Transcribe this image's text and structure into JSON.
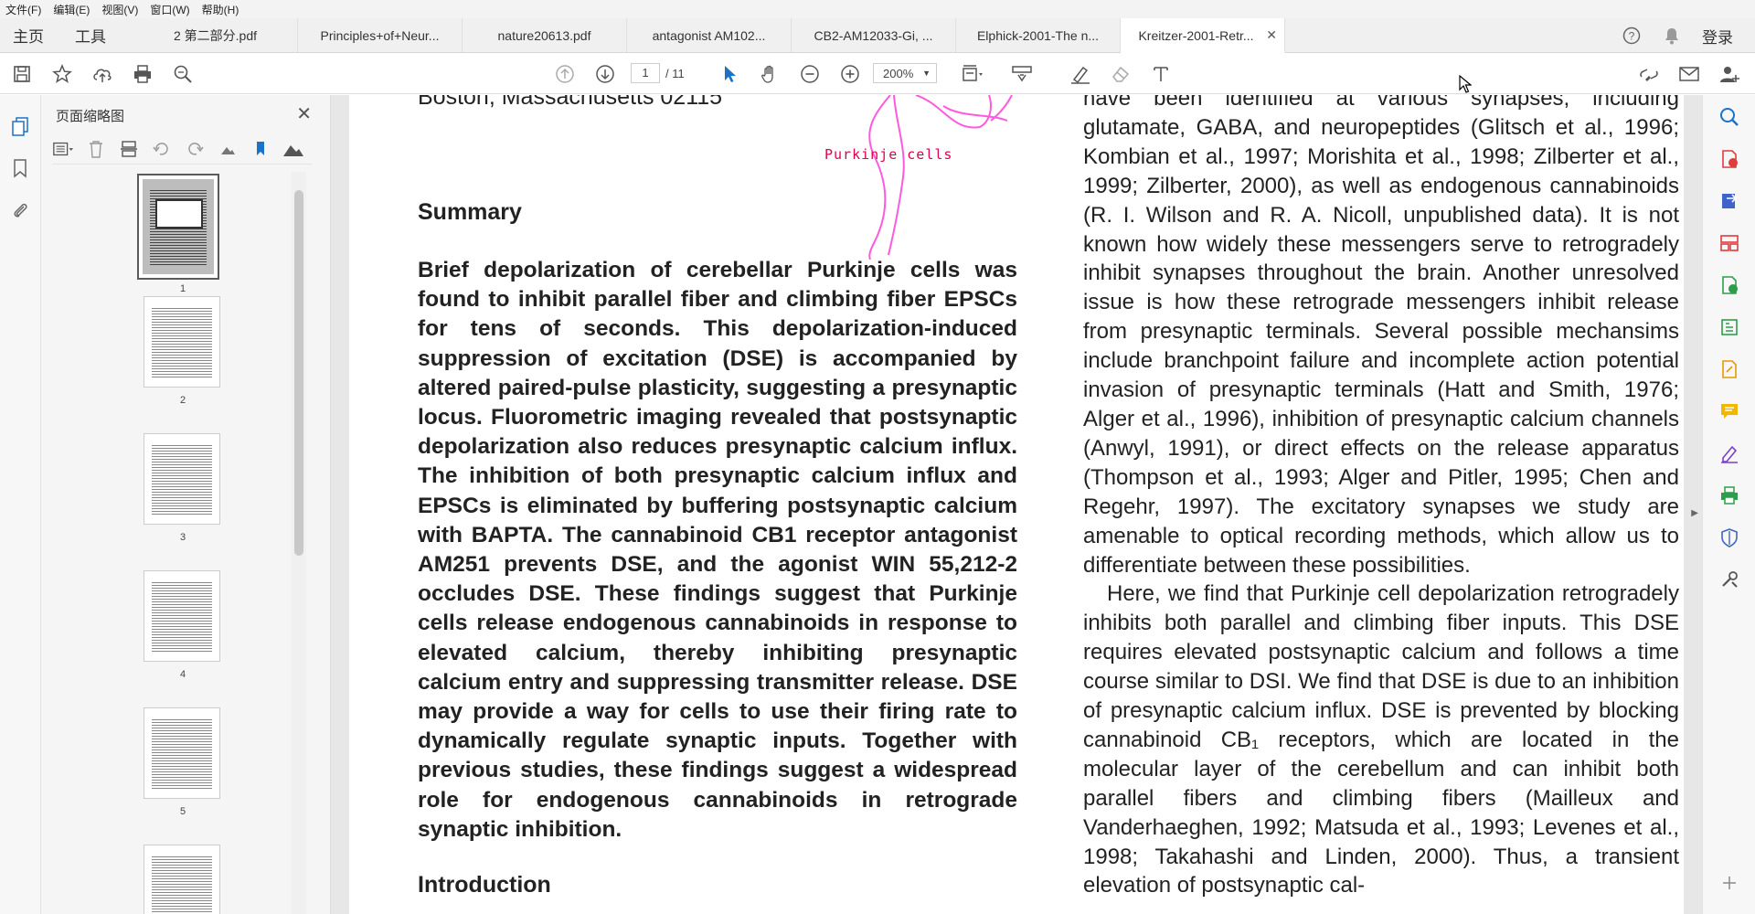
{
  "menu": [
    "文件(F)",
    "编辑(E)",
    "视图(V)",
    "窗口(W)",
    "帮助(H)"
  ],
  "nav": {
    "home": "主页",
    "tools": "工具"
  },
  "tabs": [
    {
      "label": "2 第二部分.pdf"
    },
    {
      "label": "Principles+of+Neur..."
    },
    {
      "label": "nature20613.pdf"
    },
    {
      "label": "antagonist AM102..."
    },
    {
      "label": "CB2-AM12033-Gi, ..."
    },
    {
      "label": "Elphick-2001-The n..."
    },
    {
      "label": "Kreitzer-2001-Retr..."
    }
  ],
  "login_label": "登录",
  "toolbar": {
    "current_page": "1",
    "total_pages": "/ 11",
    "zoom": "200%"
  },
  "thumbnail_panel": {
    "title": "页面缩略图",
    "page_numbers": [
      "1",
      "2",
      "3",
      "4",
      "5"
    ]
  },
  "document": {
    "affiliation": "Boston, Massachusetts 02115",
    "annotation": "Purkinje cells",
    "summary_heading": "Summary",
    "abstract": "Brief depolarization of cerebellar Purkinje cells was found to inhibit parallel fiber and climbing fiber EPSCs for tens of seconds. This depolarization-induced suppression of excitation (DSE) is accompanied by altered paired-pulse plasticity, suggesting a presynaptic locus. Fluorometric imaging revealed that postsynaptic depolarization also reduces presynaptic calcium influx. The inhibition of both presynaptic calcium influx and EPSCs is eliminated by buffering postsynaptic calcium with BAPTA. The cannabinoid CB1 receptor antagonist AM251 prevents DSE, and the agonist WIN 55,212-2 occludes DSE. These findings suggest that Purkinje cells release endogenous cannabinoids in response to elevated calcium, thereby inhibiting presynaptic calcium entry and suppressing transmitter release. DSE may provide a way for cells to use their firing rate to dynamically regulate synaptic inputs. Together with previous studies, these findings suggest a widespread role for endogenous cannabinoids in retrograde synaptic inhibition.",
    "intro_heading": "Introduction",
    "right_paragraph_1": "have been identified at various synapses, including glutamate, GABA, and neuropeptides (Glitsch et al., 1996; Kombian et al., 1997; Morishita et al., 1998; Zilberter et al., 1999; Zilberter, 2000), as well as endogenous cannabinoids (R. I. Wilson and R. A. Nicoll, unpublished data). It is not known how widely these messengers serve to retrogradely inhibit synapses throughout the brain. Another unresolved issue is how these retrograde messengers inhibit release from presynaptic terminals. Several possible mechansims include branchpoint failure and incomplete action potential invasion of presynaptic terminals (Hatt and Smith, 1976; Alger et al., 1996), inhibition of presynaptic calcium channels (Anwyl, 1991), or direct effects on the release apparatus (Thompson et al., 1993; Alger and Pitler, 1995; Chen and Regehr, 1997). The excitatory synapses we study are amenable to optical recording methods, which allow us to differentiate between these possibilities.",
    "right_paragraph_2": "Here, we find that Purkinje cell depolarization retrogradely inhibits both parallel and climbing fiber inputs. This DSE requires elevated postsynaptic calcium and follows a time course similar to DSI. We find that DSE is due to an inhibition of presynaptic calcium influx. DSE is prevented by blocking cannabinoid CB₁ receptors, which are located in the molecular layer of the cerebellum and can inhibit both parallel fibers and climbing fibers (Mailleux and Vanderhaeghen, 1992; Matsuda et al., 1993; Levenes et al., 1998; Takahashi and Linden, 2000). Thus, a transient elevation of postsynaptic cal-"
  },
  "colors": {
    "annotation": "#e0004a",
    "ink": "#ff5adf",
    "accent": "#1a73c8"
  }
}
